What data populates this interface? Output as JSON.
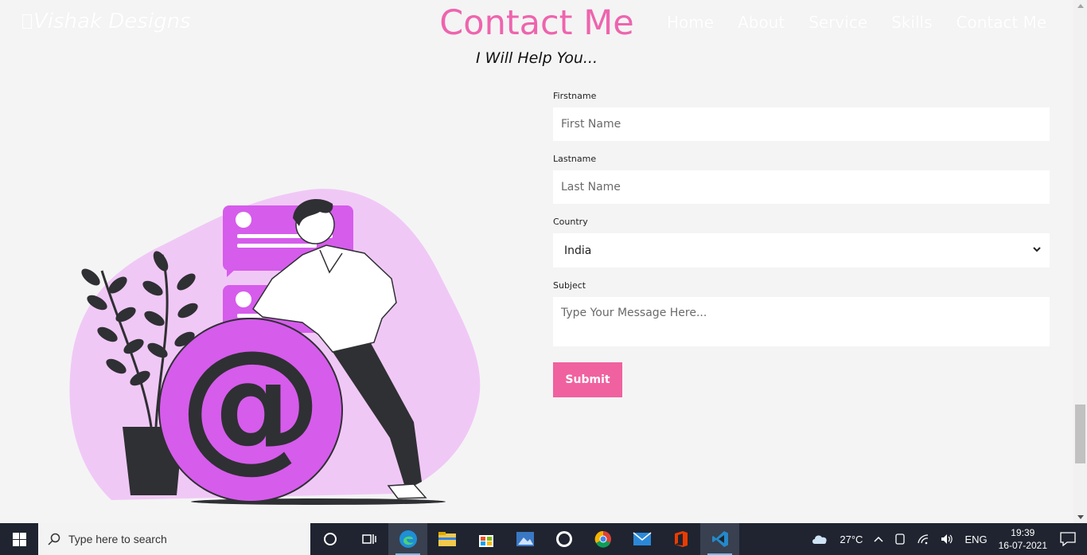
{
  "header": {
    "logo": "Vishak Designs",
    "nav": [
      "Home",
      "About",
      "Service",
      "Skills",
      "Contact Me"
    ]
  },
  "section": {
    "title": "Contact Me",
    "subtitle": "I Will Help You..."
  },
  "form": {
    "firstname_label": "Firstname",
    "firstname_placeholder": "First Name",
    "lastname_label": "Lastname",
    "lastname_placeholder": "Last Name",
    "country_label": "Country",
    "country_value": "India",
    "subject_label": "Subject",
    "subject_placeholder": "Type Your Message Here...",
    "submit_label": "Submit"
  },
  "taskbar": {
    "search_placeholder": "Type here to search",
    "weather": "27°C",
    "language": "ENG",
    "time": "19:39",
    "date": "16-07-2021"
  },
  "colors": {
    "accent": "#ee64ae",
    "button": "#f0619f",
    "illustration": "#d65cec"
  }
}
